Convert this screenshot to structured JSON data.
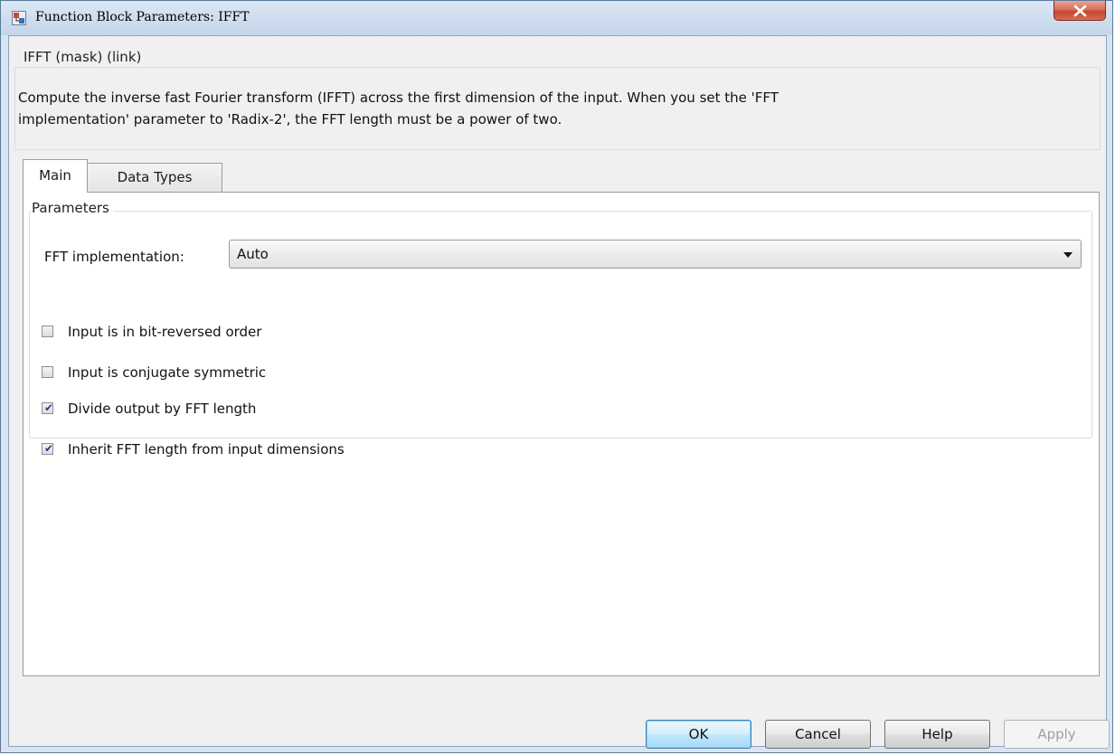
{
  "window": {
    "title": "Function Block Parameters: IFFT"
  },
  "description": {
    "legend": "IFFT (mask) (link)",
    "text_line1": "Compute the inverse fast Fourier transform (IFFT) across the first dimension of the input. When you set the 'FFT",
    "text_line2": "implementation' parameter to 'Radix-2', the FFT length must be a power of two."
  },
  "tabs": [
    {
      "label": "Main",
      "active": true
    },
    {
      "label": "Data Types",
      "active": false
    }
  ],
  "parameters": {
    "legend": "Parameters",
    "fft_implementation_label": "FFT implementation:",
    "fft_implementation_value": "Auto",
    "checkboxes": [
      {
        "label": "Input is in bit-reversed order",
        "checked": false
      },
      {
        "label": "Input is conjugate symmetric",
        "checked": false
      },
      {
        "label": "Divide output by FFT length",
        "checked": true
      },
      {
        "label": "Inherit FFT length from input dimensions",
        "checked": true
      }
    ]
  },
  "buttons": {
    "ok": "OK",
    "cancel": "Cancel",
    "help": "Help",
    "apply": "Apply"
  },
  "icons": {
    "app": "simulink-block-icon",
    "close": "close-icon",
    "dropdown": "chevron-down-icon",
    "check": "checkmark-icon"
  },
  "colors": {
    "titlebar": "#cfdeef",
    "close_button": "#c54732",
    "ok_button_border": "#3c7fb1",
    "checkmark": "#1f3d8a"
  }
}
